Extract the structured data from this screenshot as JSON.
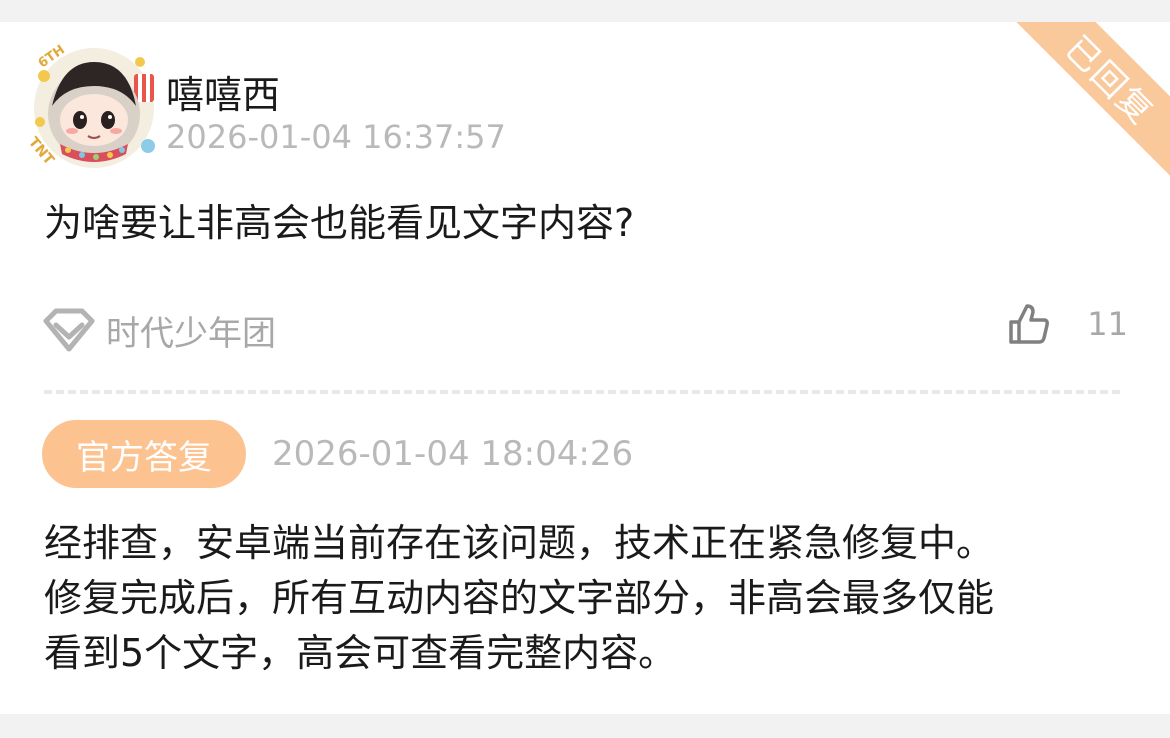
{
  "post": {
    "status_ribbon": "已回复",
    "username": "嘻嘻西",
    "timestamp": "2026-01-04 16:37:57",
    "question": "为啥要让非高会也能看见文字内容?",
    "tag": "时代少年团",
    "like_count": "11"
  },
  "avatar": {
    "badge_text": "6TH",
    "side_text": "TNT"
  },
  "reply": {
    "badge": "官方答复",
    "timestamp": "2026-01-04 18:04:26",
    "lines": [
      "经排查，安卓端当前存在该问题，技术正在紧急修复中。",
      "修复完成后，所有互动内容的文字部分，非高会最多仅能",
      "看到5个文字，高会可查看完整内容。"
    ]
  },
  "colors": {
    "accent_orange": "#fcc391",
    "text_primary": "#1a1a1a",
    "text_muted": "#b9b9b9"
  }
}
